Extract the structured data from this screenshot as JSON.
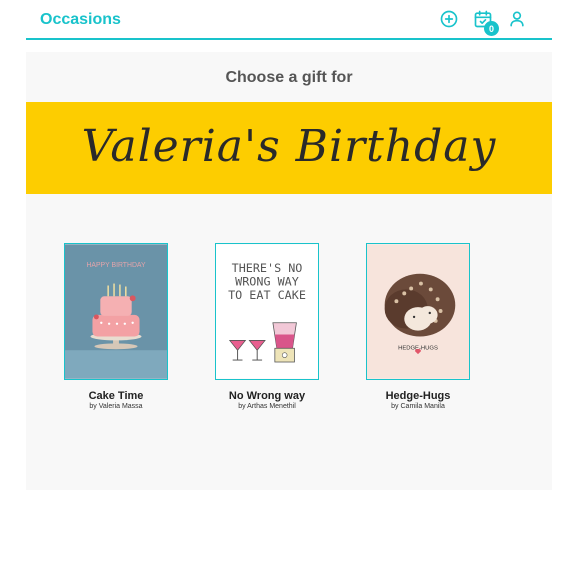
{
  "header": {
    "title": "Occasions",
    "cart_count": "0",
    "icons": [
      "add-circle-icon",
      "calendar-check-icon",
      "user-icon"
    ]
  },
  "main": {
    "choose_text": "Choose a gift for",
    "banner_title": "Valeria's Birthday",
    "cards": [
      {
        "title": "Cake Time",
        "by": "by Valeria Massa",
        "image_text": "HAPPY BIRTHDAY"
      },
      {
        "title": "No Wrong way",
        "by": "by Arthas Menethil",
        "image_text": [
          "THERE'S NO",
          "WRONG WAY",
          "TO EAT CAKE"
        ]
      },
      {
        "title": "Hedge-Hugs",
        "by": "by Camila Manila",
        "image_text": "HEDGE-HUGS"
      }
    ]
  },
  "colors": {
    "accent": "#19c3cb",
    "banner": "#fdcd00",
    "panel": "#f8f8f8"
  }
}
